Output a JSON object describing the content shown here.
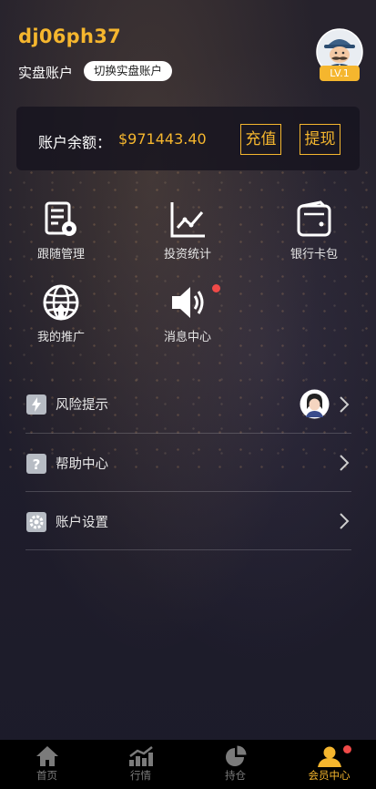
{
  "header": {
    "username": "dj06ph37",
    "account_type": "实盘账户",
    "switch_button": "切换实盘账户",
    "level_badge": "LV.1"
  },
  "balance": {
    "label": "账户余额：",
    "value": "$971443.40",
    "recharge": "充值",
    "withdraw": "提现"
  },
  "grid": [
    {
      "label": "跟随管理",
      "icon": "document-gear-icon"
    },
    {
      "label": "投资统计",
      "icon": "line-chart-icon"
    },
    {
      "label": "银行卡包",
      "icon": "wallet-icon"
    },
    {
      "label": "我的推广",
      "icon": "globe-icon"
    },
    {
      "label": "消息中心",
      "icon": "speaker-icon"
    }
  ],
  "list": [
    {
      "label": "风险提示",
      "icon": "lightning-icon"
    },
    {
      "label": "帮助中心",
      "icon": "question-icon"
    },
    {
      "label": "账户设置",
      "icon": "settings-icon"
    }
  ],
  "tabbar": [
    {
      "label": "首页",
      "icon": "home-icon"
    },
    {
      "label": "行情",
      "icon": "market-chart-icon"
    },
    {
      "label": "持仓",
      "icon": "pie-chart-icon"
    },
    {
      "label": "会员中心",
      "icon": "user-icon",
      "active": true
    }
  ],
  "colors": {
    "accent": "#f5b62e",
    "notification_dot": "#f04a48",
    "tabbar_bg": "#000000"
  }
}
